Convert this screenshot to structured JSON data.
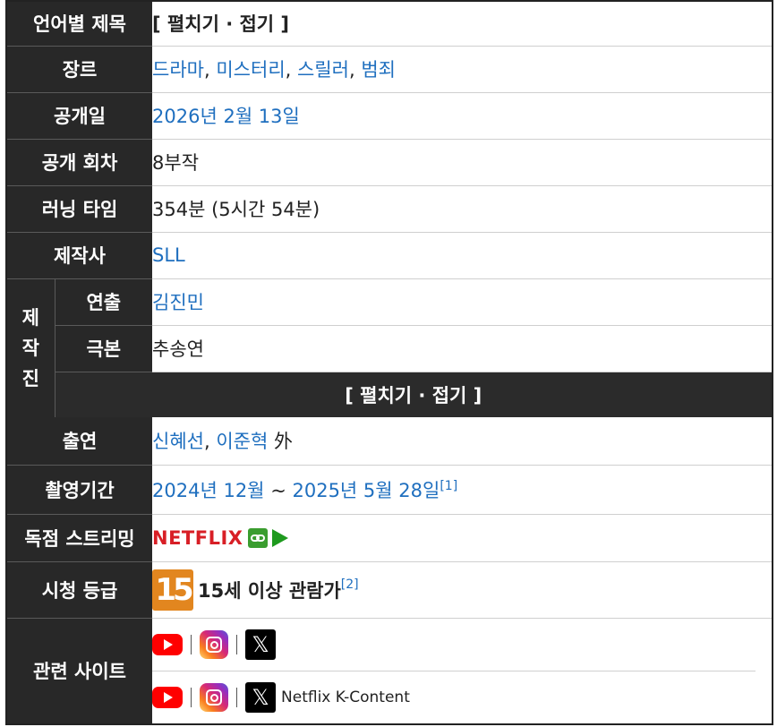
{
  "rows": {
    "title_lang": {
      "label": "언어별 제목",
      "value": "[ 펼치기 · 접기 ]"
    },
    "genre": {
      "label": "장르",
      "items": [
        "드라마",
        "미스터리",
        "스릴러",
        "범죄"
      ],
      "sep": ","
    },
    "release": {
      "label": "공개일",
      "value": "2026년 2월 13일"
    },
    "episodes": {
      "label": "공개 회차",
      "value": "8부작"
    },
    "runtime": {
      "label": "러닝 타임",
      "value": "354분 (5시간 54분)"
    },
    "studio": {
      "label": "제작사",
      "value": "SLL"
    },
    "crew": {
      "label": [
        "제",
        "작",
        "진"
      ],
      "director": {
        "label": "연출",
        "value": "김진민"
      },
      "writer": {
        "label": "극본",
        "value": "추송연"
      },
      "toggle": "[ 펼치기 · 접기 ]"
    },
    "cast": {
      "label": "출연",
      "items": [
        "신혜선",
        "이준혁"
      ],
      "sep": ",",
      "suffix": "外"
    },
    "filming": {
      "label": "촬영기간",
      "start": "2024년 12월",
      "tilde": "~",
      "end": "2025년 5월 28일",
      "ref": "[1]"
    },
    "streaming": {
      "label": "독점 스트리밍",
      "service": "NETFLIX"
    },
    "rating": {
      "label": "시청 등급",
      "badge": "15",
      "text": "15세 이상 관람가",
      "ref": "[2]"
    },
    "sites": {
      "label": "관련 사이트",
      "second_row_label": "Netflix K-Content"
    }
  },
  "icons": {
    "link": "link-icon",
    "play": "play-icon",
    "youtube": "youtube-icon",
    "instagram": "instagram-icon",
    "x": "x-icon"
  },
  "colors": {
    "label_bg": "#282828",
    "link": "#1f6fbf",
    "netflix": "#d81f26",
    "rating": "#e2861f"
  }
}
